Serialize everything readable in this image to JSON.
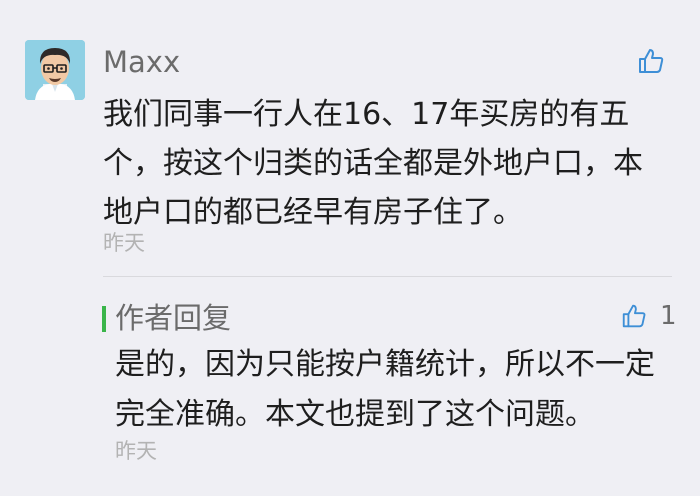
{
  "comment": {
    "author": "Maxx",
    "text": "我们同事一行人在16、17年买房的有五个，按这个归类的话全都是外地户口，本地户口的都已经早有房子住了。",
    "time": "昨天",
    "like_icon": "thumbs-up-icon"
  },
  "reply": {
    "label": "作者回复",
    "text": "是的，因为只能按户籍统计，所以不一定完全准确。本文也提到了这个问题。",
    "time": "昨天",
    "like_count": "1",
    "like_icon": "thumbs-up-icon"
  },
  "colors": {
    "background": "#efeff4",
    "accent_bar": "#3ab54a",
    "like_icon": "#3e8fd6"
  }
}
